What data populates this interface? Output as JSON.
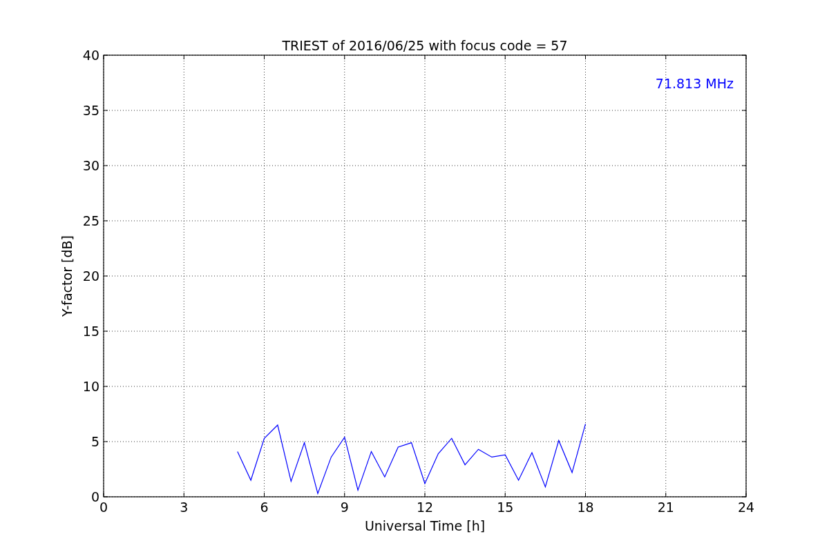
{
  "chart_data": {
    "type": "line",
    "title": "TRIEST of 2016/06/25 with focus code = 57",
    "xlabel": "Universal Time [h]",
    "ylabel": "Y-factor [dB]",
    "xlim": [
      0,
      24
    ],
    "ylim": [
      0,
      40
    ],
    "xticks": [
      0,
      3,
      6,
      9,
      12,
      15,
      18,
      21,
      24
    ],
    "yticks": [
      0,
      5,
      10,
      15,
      20,
      25,
      30,
      35,
      40
    ],
    "series": [
      {
        "name": "71.813 MHz",
        "color": "#0000ff",
        "x": [
          5,
          5.5,
          6,
          6.5,
          7,
          7.5,
          8,
          8.5,
          9,
          9.5,
          10,
          10.5,
          11,
          11.5,
          12,
          12.5,
          13,
          13.5,
          14,
          14.5,
          15,
          15.5,
          16,
          16.5,
          17,
          17.5,
          18
        ],
        "values": [
          4.1,
          1.5,
          5.3,
          6.5,
          1.4,
          4.9,
          0.3,
          3.6,
          5.4,
          0.6,
          4.1,
          1.8,
          4.5,
          4.9,
          1.2,
          3.9,
          5.3,
          2.9,
          4.3,
          3.6,
          3.8,
          1.5,
          4.0,
          0.9,
          5.1,
          2.2,
          6.6
        ]
      }
    ],
    "grid": true
  }
}
